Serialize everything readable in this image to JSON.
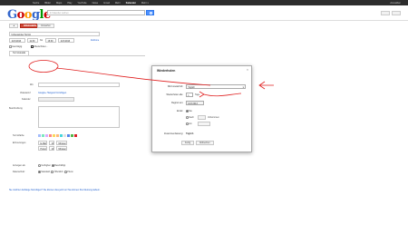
{
  "topbar": {
    "nav": [
      "Suche",
      "Bilder",
      "Maps",
      "Play",
      "YouTube",
      "News",
      "Gmail",
      "Mehr",
      "Kalender",
      "Mehr ▾"
    ],
    "active_index": 8,
    "account": "Anmelden"
  },
  "search": {
    "placeholder": "In Kalender suchen"
  },
  "toolbar": {
    "back_label": "◄",
    "save_label": "SPEICHERN",
    "discard_label": "Verwerfen"
  },
  "event": {
    "title": "Unbenannter Termin",
    "start_date": "12.8.2013",
    "start_time": "11:30",
    "time_sep": "bis",
    "end_time": "16:30",
    "end_date": "12.8.2013",
    "timezone_link": "Zeitzone",
    "allday_label": "Ganztägig",
    "repeat_label": "Wiederholen...",
    "details_tab": "Termindetails",
    "where_label": "Wo",
    "calendar_label": "Kalender",
    "video_label": "Videoanruf",
    "video_link": "Google+ Hangout hinzufügen",
    "description_label": "Beschreibung",
    "color_label": "Terminfarbe",
    "reminder_label": "Erinnerungen",
    "reminder1": [
      "E-Mail",
      "10",
      "Minuten"
    ],
    "reminder2": [
      "Popup",
      "10",
      "Minuten"
    ],
    "show_as_label": "Anzeigen als",
    "show_as_opts": [
      "Verfügbar",
      "Beschäftigt"
    ],
    "privacy_label": "Datenschutz",
    "privacy_opts": [
      "Standard",
      "Öffentlich",
      "Privat"
    ],
    "footer_link": "Sie möchten Anhänge hinzufügen? Sie können dies jetzt tun! Sie können Ihre Meinung äußern."
  },
  "dialog": {
    "title": "Wiederholen",
    "repeat_label": "Wird wiederholt:",
    "repeat_value": "Täglich",
    "interval_label": "Wiederholen alle:",
    "interval_value": "1",
    "interval_unit": "Tage",
    "start_label": "Beginnt am:",
    "start_value": "12.8.2013",
    "end_label": "Endet:",
    "end_opt1": "Nie",
    "end_opt2": "Nach",
    "end_opt2_suffix": "Vorkommen",
    "end_opt3": "Am",
    "summary_label": "Zusammenfassung:",
    "summary_value": "Täglich",
    "done_label": "Fertig",
    "cancel_label": "Abbrechen"
  },
  "colors": {
    "annotation": "#e02020",
    "primary": "#d14836",
    "link": "#1155cc"
  }
}
